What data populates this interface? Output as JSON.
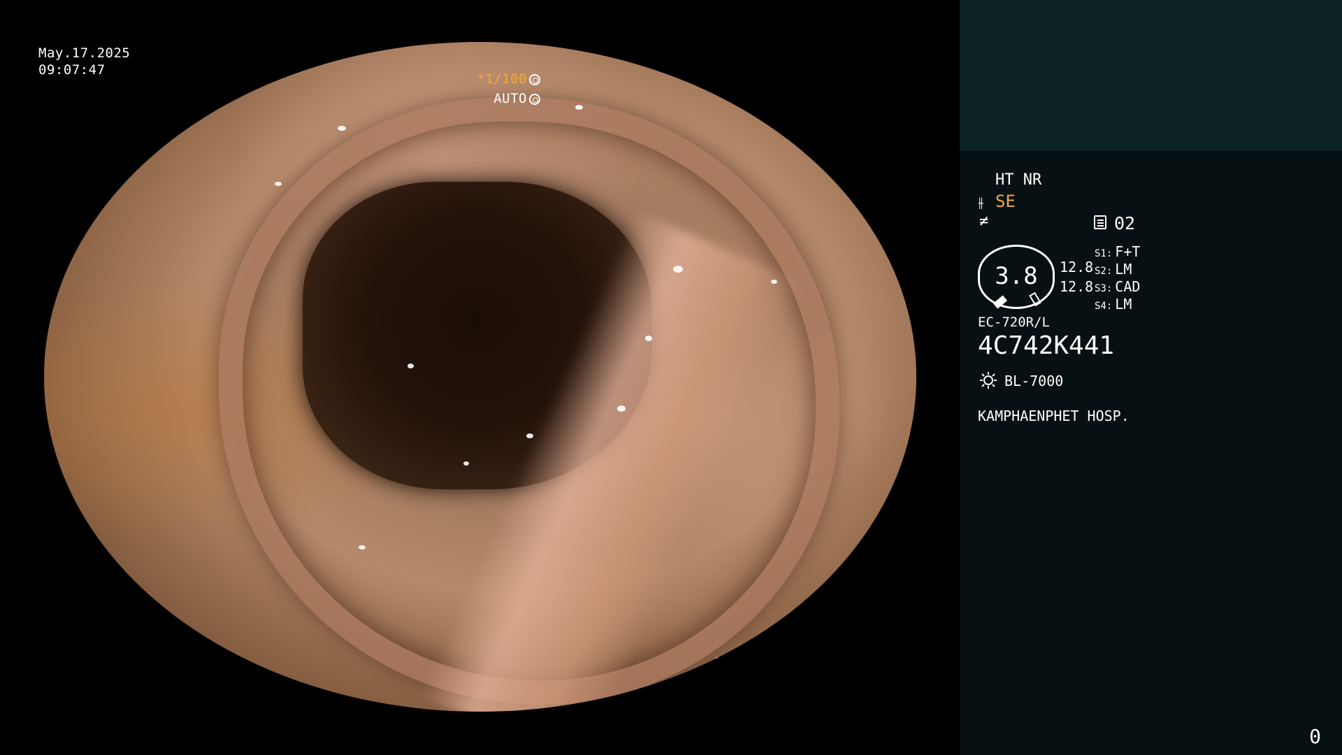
{
  "overlay": {
    "date": "May.17.2025",
    "time": "09:07:47",
    "shutter": "*1/100",
    "iris": "AUTO"
  },
  "panel": {
    "mode": "HT NR",
    "enhance": "SE",
    "memory_label": "02",
    "gauge_value": "3.8",
    "value1": "12.8",
    "value2": "12.8",
    "switches": [
      {
        "label": "S1:",
        "value": "F+T"
      },
      {
        "label": "S2:",
        "value": "LM"
      },
      {
        "label": "S3:",
        "value": "CAD"
      },
      {
        "label": "S4:",
        "value": "LM"
      }
    ],
    "scope_model": "EC-720R/L",
    "scope_serial": "4C742K441",
    "light_source": "BL-7000",
    "hospital": "KAMPHAENPHET HOSP.",
    "counter": "0"
  },
  "colors": {
    "accent": "#f2a93a",
    "panel_bg": "#071012",
    "panel_top_bg": "#0c2326"
  }
}
